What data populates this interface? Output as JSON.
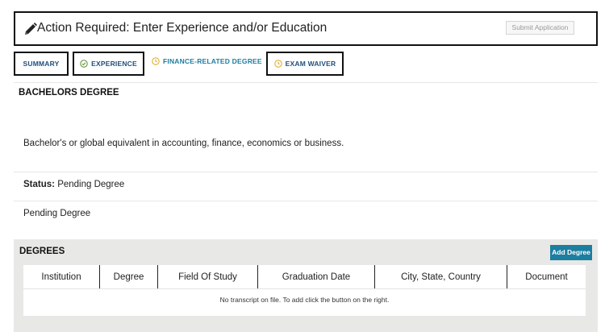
{
  "header": {
    "title": "Action Required: Enter Experience and/or Education",
    "submit_label": "Submit Application"
  },
  "tabs": [
    {
      "label": "SUMMARY",
      "icon": "none",
      "boxed": true
    },
    {
      "label": "EXPERIENCE",
      "icon": "check-circle-icon",
      "icon_color": "#5a8a2e",
      "boxed": true
    },
    {
      "label": "FINANCE-RELATED DEGREE",
      "icon": "clock-icon",
      "icon_color": "#e0a81c",
      "boxed": false,
      "active": true
    },
    {
      "label": "EXAM WAIVER",
      "icon": "clock-icon",
      "icon_color": "#e0a81c",
      "boxed": true
    }
  ],
  "section": {
    "title": "BACHELORS DEGREE",
    "description": "Bachelor's or global equivalent in accounting, finance, economics or business.",
    "status_label": "Status:",
    "status_value": "Pending Degree",
    "pending_text": "Pending Degree"
  },
  "degrees": {
    "title": "DEGREES",
    "add_label": "Add Degree",
    "columns": [
      "Institution",
      "Degree",
      "Field Of Study",
      "Graduation Date",
      "City, State, Country",
      "Document"
    ],
    "empty_message": "No transcript on file. To add click the button on the right."
  },
  "colors": {
    "accent": "#1c7ea0",
    "tab_text": "#1f4f7a",
    "pending_icon": "#e0a81c",
    "complete_icon": "#5a8a2e",
    "panel_bg": "#e8e8e6"
  }
}
